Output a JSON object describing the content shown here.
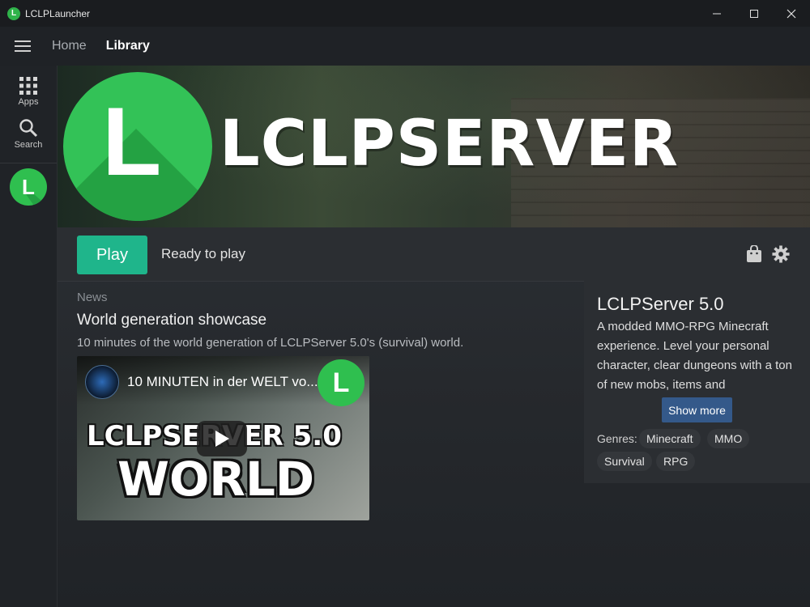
{
  "window": {
    "title": "LCLPLauncher",
    "icon_letter": "L"
  },
  "nav": {
    "home": "Home",
    "library": "Library"
  },
  "sidebar": {
    "apps_label": "Apps",
    "search_label": "Search",
    "game_icon_letter": "L"
  },
  "banner": {
    "logo_letter": "L",
    "title": "LCLPSERVER"
  },
  "playbar": {
    "play_label": "Play",
    "status": "Ready to play"
  },
  "news": {
    "label": "News",
    "title": "World generation showcase",
    "description": "10 minutes of the world generation of LCLPServer 5.0's (survival) world.",
    "video": {
      "title": "10 MINUTEN in der WELT vo...",
      "channel_logo_letter": "L",
      "thumb_line1": "LCLPSERVER 5.0",
      "thumb_line2": "WORLD"
    }
  },
  "game_info": {
    "title": "LCLPServer 5.0",
    "description": "A modded MMO-RPG Minecraft experience. Level your personal character, clear dungeons with a ton of new mobs, items and",
    "show_more": "Show more",
    "genres_label": "Genres:",
    "genres": [
      "Minecraft",
      "MMO",
      "Survival",
      "RPG"
    ]
  },
  "colors": {
    "play": "#1fb58b",
    "show_more": "#34598a",
    "brand_green": "#33c257"
  }
}
